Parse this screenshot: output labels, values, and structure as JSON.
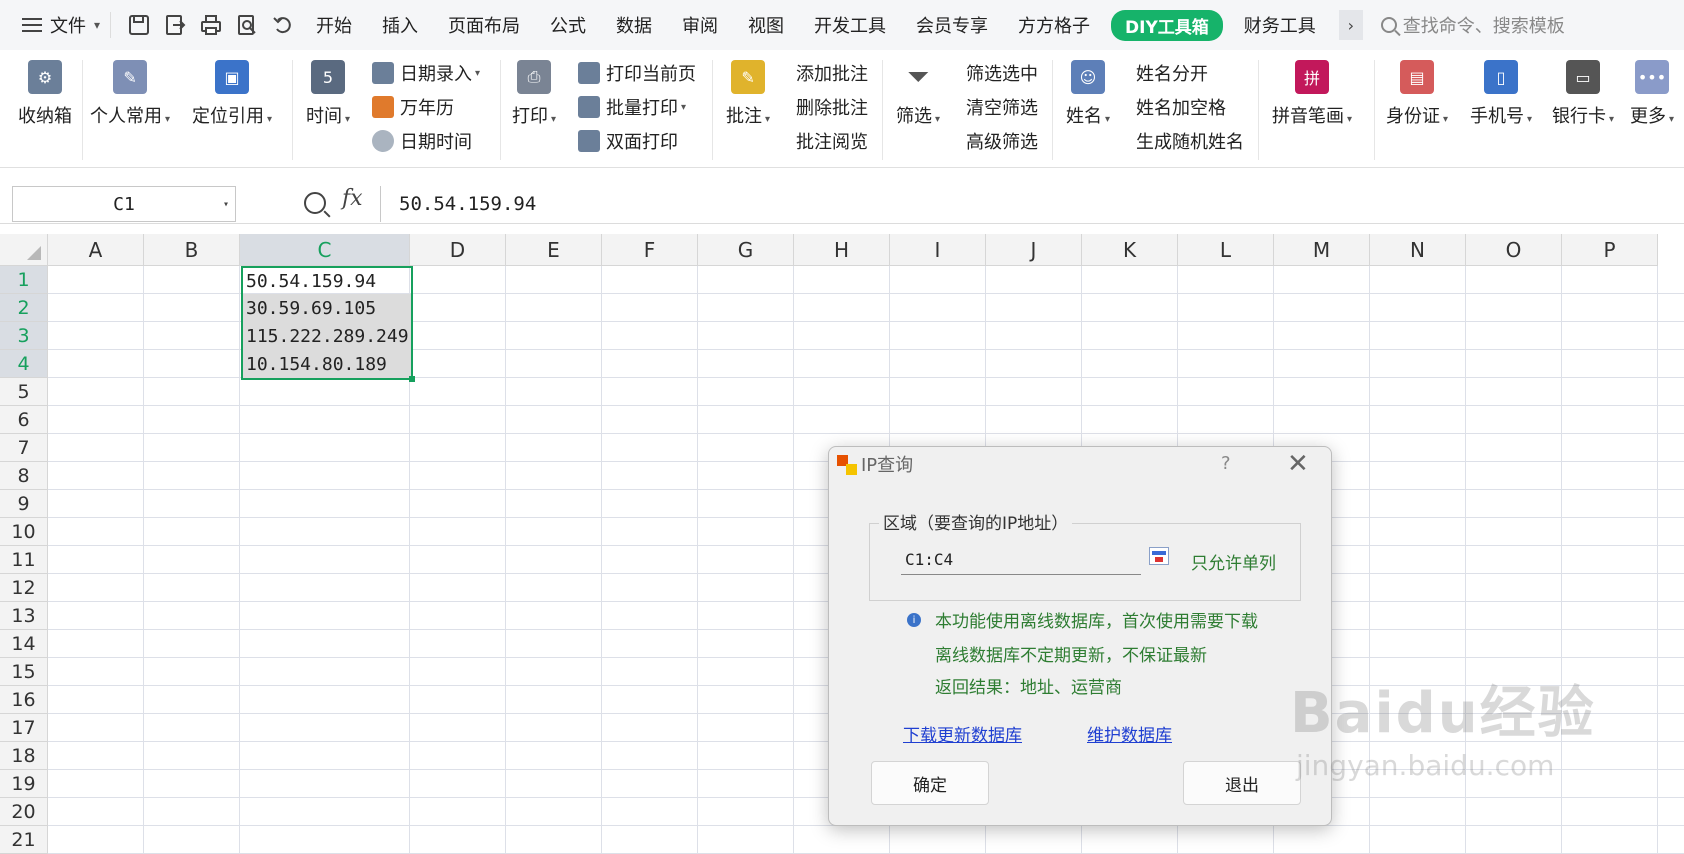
{
  "menubar": {
    "file_label": "文件",
    "tabs": [
      "开始",
      "插入",
      "页面布局",
      "公式",
      "数据",
      "审阅",
      "视图",
      "开发工具",
      "会员专享",
      "方方格子"
    ],
    "active_tab": "DIY工具箱",
    "tab_after": "财务工具",
    "more": "›",
    "search_placeholder": "查找命令、搜索模板",
    "accent_color": "#16b36a"
  },
  "ribbon": {
    "toolbox": "收纳箱",
    "personal": "个人常用",
    "locate_ref": "定位引用",
    "time": "时间",
    "date_entry": "日期录入",
    "calendar": "万年历",
    "date_time": "日期时间",
    "print": "打印",
    "print_current": "打印当前页",
    "batch_print": "批量打印",
    "duplex_print": "双面打印",
    "comment": "批注",
    "add_comment": "添加批注",
    "delete_comment": "删除批注",
    "view_comment": "批注阅览",
    "filter": "筛选",
    "filter_selected": "筛选选中",
    "clear_filter": "清空筛选",
    "advanced_filter": "高级筛选",
    "name": "姓名",
    "split_name": "姓名分开",
    "name_space": "姓名加空格",
    "random_name": "生成随机姓名",
    "pinyin": "拼音笔画",
    "id_card": "身份证",
    "phone": "手机号",
    "bank_card": "银行卡",
    "more": "更多"
  },
  "formulabar": {
    "name_box": "C1",
    "fx": "fx",
    "formula": "50.54.159.94"
  },
  "grid": {
    "columns": [
      "A",
      "B",
      "C",
      "D",
      "E",
      "F",
      "G",
      "H",
      "I",
      "J",
      "K",
      "L",
      "M",
      "N",
      "O",
      "P"
    ],
    "rows": [
      "1",
      "2",
      "3",
      "4",
      "5",
      "6",
      "7",
      "8",
      "9",
      "10",
      "11",
      "12",
      "13",
      "14",
      "15",
      "16",
      "17",
      "18",
      "19",
      "20",
      "21"
    ],
    "selected_column": "C",
    "cells": [
      "50.54.159.94",
      "30.59.69.105",
      "115.222.289.249",
      "10.154.80.189"
    ],
    "selection_color": "#16a05d"
  },
  "dialog": {
    "title": "IP查询",
    "help": "?",
    "close": "✕",
    "group_label": "区域（要查询的IP地址）",
    "range_value": "C1:C4",
    "single_column": "只允许单列",
    "note1": "本功能使用离线数据库，首次使用需要下载",
    "note2": "离线数据库不定期更新，不保证最新",
    "note3": "返回结果：地址、运营商",
    "link_download": "下载更新数据库",
    "link_maintain": "维护数据库",
    "ok": "确定",
    "exit": "退出"
  },
  "watermark": {
    "logo": "Baidu经验",
    "url": "jingyan.baidu.com"
  }
}
